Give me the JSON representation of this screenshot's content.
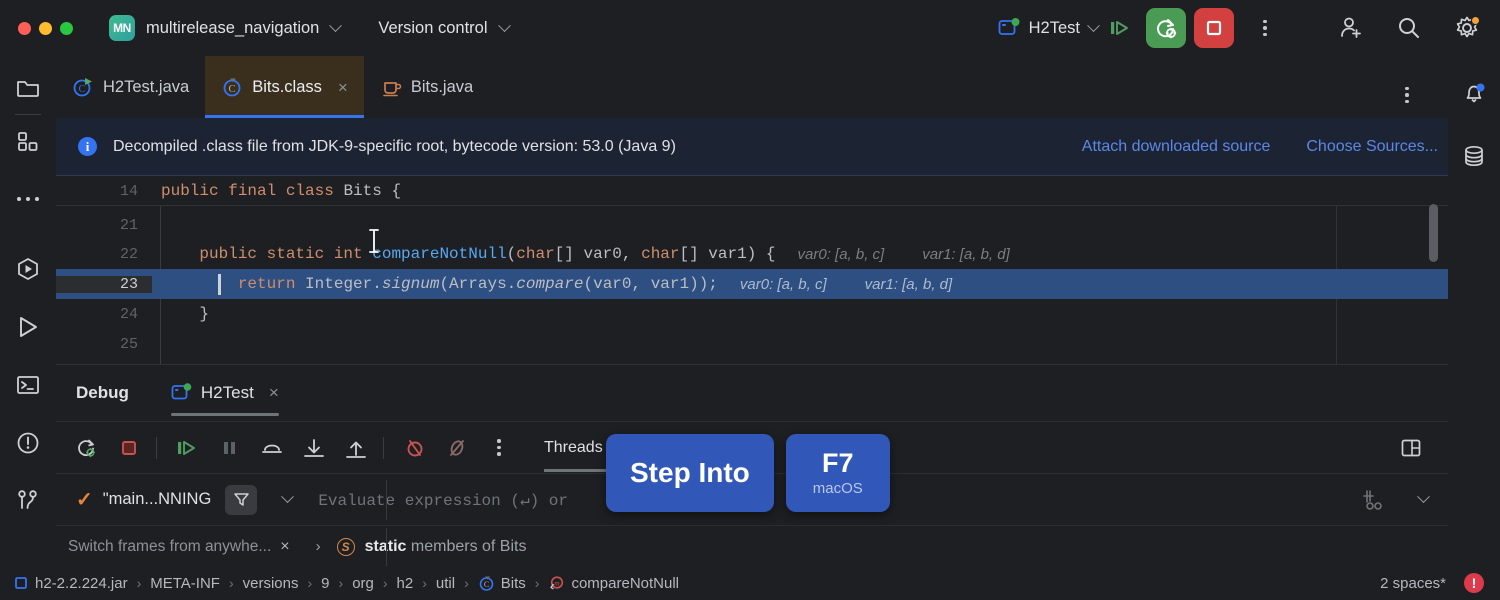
{
  "titlebar": {
    "project_badge": "MN",
    "project_name": "multirelease_navigation",
    "vcs_label": "Version control",
    "run_config": "H2Test",
    "icons": {
      "traffic_close": "close-window-dot",
      "traffic_min": "minimize-window-dot",
      "traffic_max": "maximize-window-dot",
      "step_over": "step-over-icon",
      "restart_debug": "restart-debug-icon",
      "stop": "stop-icon",
      "more": "more-options-icon",
      "add_user": "add-user-icon",
      "search": "search-icon",
      "settings": "settings-gear-icon"
    }
  },
  "rail_left": [
    {
      "name": "project-tool-window",
      "icon": "folder-icon"
    },
    {
      "name": "structure-tool-window",
      "icon": "structure-grid-icon"
    },
    {
      "name": "more-tool-windows",
      "icon": "ellipsis-icon"
    },
    {
      "name": "debug-tool-window",
      "icon": "debug-hex-play-icon"
    },
    {
      "name": "run-tool-window",
      "icon": "run-play-icon"
    },
    {
      "name": "terminal-tool-window",
      "icon": "terminal-icon"
    },
    {
      "name": "problems-tool-window",
      "icon": "warning-circle-icon"
    },
    {
      "name": "version-control-tool-window",
      "icon": "branch-icon"
    }
  ],
  "rail_right": [
    {
      "name": "notifications",
      "icon": "bell-icon",
      "badge": true
    },
    {
      "name": "database-tool-window",
      "icon": "database-icon"
    }
  ],
  "tabs": [
    {
      "label": "H2Test.java",
      "icon": "java-class-run-icon",
      "active": false,
      "closable": false
    },
    {
      "label": "Bits.class",
      "icon": "compiled-class-icon",
      "active": true,
      "closable": true,
      "close_label": "×"
    },
    {
      "label": "Bits.java",
      "icon": "java-file-coffee-icon",
      "active": false,
      "closable": false
    }
  ],
  "banner": {
    "message": "Decompiled .class file from JDK-9-specific root, bytecode version: 53.0 (Java 9)",
    "info_glyph": "i",
    "links": [
      "Attach downloaded source",
      "Choose Sources..."
    ]
  },
  "editor": {
    "lines": [
      {
        "number": "14",
        "highlighted": false,
        "segments": [
          {
            "t": "public final ",
            "c": "kw"
          },
          {
            "t": "class ",
            "c": "kw"
          },
          {
            "t": "Bits {",
            "c": "plain"
          }
        ],
        "hints": []
      },
      {
        "number": "21",
        "highlighted": false,
        "segments": [],
        "hints": []
      },
      {
        "number": "22",
        "highlighted": false,
        "segments": [
          {
            "t": "    public static int ",
            "c": "kw"
          },
          {
            "t": "compareNotNull",
            "c": "meth"
          },
          {
            "t": "(",
            "c": "plain"
          },
          {
            "t": "char",
            "c": "kw"
          },
          {
            "t": "[] var0, ",
            "c": "plain"
          },
          {
            "t": "char",
            "c": "kw"
          },
          {
            "t": "[] var1) {",
            "c": "plain"
          }
        ],
        "hints": [
          "var0: [a, b, c]",
          "var1: [a, b, d]"
        ]
      },
      {
        "number": "23",
        "highlighted": true,
        "segments": [
          {
            "t": "        return ",
            "c": "kw"
          },
          {
            "t": "Integer.",
            "c": "plain"
          },
          {
            "t": "signum",
            "c": "ital"
          },
          {
            "t": "(Arrays.",
            "c": "plain"
          },
          {
            "t": "compare",
            "c": "ital"
          },
          {
            "t": "(var0, var1));",
            "c": "plain"
          }
        ],
        "hints": [
          "var0: [a, b, c]",
          "var1: [a, b, d]"
        ]
      },
      {
        "number": "24",
        "highlighted": false,
        "segments": [
          {
            "t": "    }",
            "c": "plain"
          }
        ],
        "hints": []
      },
      {
        "number": "25",
        "highlighted": false,
        "segments": [],
        "hints": []
      }
    ]
  },
  "debug": {
    "title": "Debug",
    "session_tab": "H2Test",
    "session_close": "×",
    "toolbar_icons": [
      "rerun-debug-icon",
      "stop-icon",
      "resume-program-icon",
      "pause-program-icon",
      "step-over-icon",
      "step-into-icon",
      "step-out-icon",
      "mute-breakpoints-icon",
      "view-breakpoints-icon",
      "more-options-icon"
    ],
    "threads_tab": "Threads & Vari",
    "layout_icon": "layout-settings-icon",
    "frame": {
      "status_icon": "checkmark-icon",
      "label": "\"main...NNING",
      "filter_icon": "filter-funnel-icon",
      "dropdown_icon": "chevron-down-icon"
    },
    "evaluate_placeholder": "Evaluate expression (↵) or",
    "evaluate_add_icon": "add-watch-icon",
    "evaluate_chevron": "chevron-down-icon",
    "switch_frames_hint": "Switch frames from anywhe...",
    "switch_frames_close": "×",
    "variables_row": {
      "arrow": "›",
      "icon": "static-member-icon",
      "bold": "static",
      "rest": " members of Bits"
    }
  },
  "keycast": {
    "action": "Step Into",
    "key": "F7",
    "platform": "macOS"
  },
  "statusbar": {
    "breadcrumbs": [
      {
        "label": "h2-2.2.224.jar",
        "icon": "jar-icon"
      },
      {
        "label": "META-INF",
        "icon": null
      },
      {
        "label": "versions",
        "icon": null
      },
      {
        "label": "9",
        "icon": null
      },
      {
        "label": "org",
        "icon": null
      },
      {
        "label": "h2",
        "icon": null
      },
      {
        "label": "util",
        "icon": null
      },
      {
        "label": "Bits",
        "icon": "compiled-class-icon"
      },
      {
        "label": "compareNotNull",
        "icon": "method-icon"
      }
    ],
    "separator": "›",
    "indent": "2 spaces*",
    "error_glyph": "!"
  },
  "colors": {
    "accent_blue": "#3574f0",
    "highlight_line": "#2d4f82",
    "keyword_orange": "#cf8e6d",
    "method_blue": "#56a8f5",
    "banner_bg": "#1c2433",
    "tab_active_bg": "#3a2f1d",
    "error_red": "#db3b4b",
    "check_orange": "#e8833a"
  }
}
